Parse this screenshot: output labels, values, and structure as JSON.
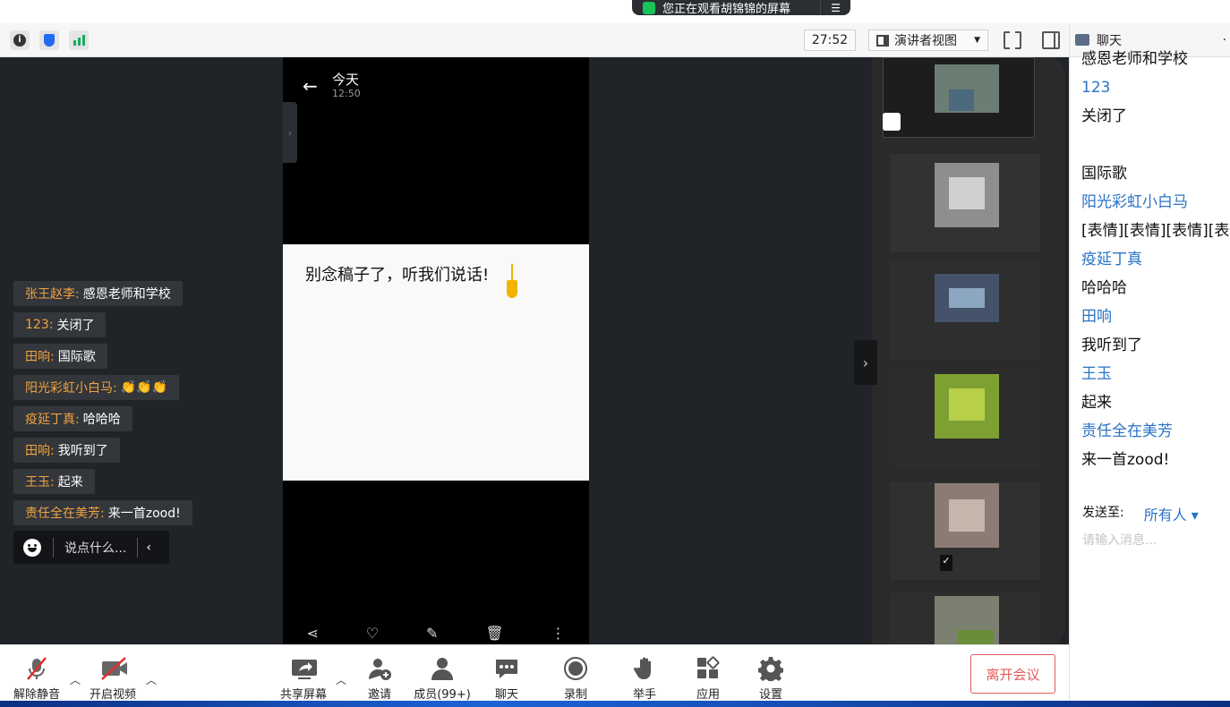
{
  "banner": {
    "text": "您正在观看胡锦锦的屏幕",
    "menu_icon": "list-icon"
  },
  "header": {
    "timer": "27:52",
    "view_mode": "演讲者视图",
    "icons": [
      "info-icon",
      "shield-icon",
      "signal-icon",
      "fullscreen-icon",
      "side-panel-icon"
    ]
  },
  "phone": {
    "day": "今天",
    "time": "12:50",
    "note_text": "别念稿子了，听我们说话!",
    "tools": [
      "share-icon",
      "heart-icon",
      "pen-icon",
      "trash-icon",
      "more-icon"
    ]
  },
  "danmaku": [
    {
      "who": "张王赵李:",
      "text": "感恩老师和学校"
    },
    {
      "who": "123:",
      "text": "关闭了"
    },
    {
      "who": "田响:",
      "text": "国际歌"
    },
    {
      "who": "阳光彩虹小白马:",
      "text": "👏👏👏"
    },
    {
      "who": "疫延丁真:",
      "text": "哈哈哈"
    },
    {
      "who": "田响:",
      "text": "我听到了"
    },
    {
      "who": "王玉:",
      "text": "起来"
    },
    {
      "who": "责任全在美芳:",
      "text": "来一首zood!"
    }
  ],
  "danmaku_input": {
    "placeholder": "说点什么..."
  },
  "chat": {
    "title": "聊天",
    "messages": [
      {
        "type": "text",
        "value": "感恩老师和学校"
      },
      {
        "type": "sender",
        "value": "123"
      },
      {
        "type": "text",
        "value": "关闭了"
      },
      {
        "type": "sender",
        "value": ""
      },
      {
        "type": "text",
        "value": "国际歌"
      },
      {
        "type": "sender",
        "value": "阳光彩虹小白马"
      },
      {
        "type": "text",
        "value": "[表情][表情][表情][表情]"
      },
      {
        "type": "sender",
        "value": "疫延丁真"
      },
      {
        "type": "text",
        "value": "哈哈哈"
      },
      {
        "type": "sender",
        "value": "田响"
      },
      {
        "type": "text",
        "value": "我听到了"
      },
      {
        "type": "sender",
        "value": "王玉"
      },
      {
        "type": "text",
        "value": "起来"
      },
      {
        "type": "sender",
        "value": "责任全在美芳"
      },
      {
        "type": "text",
        "value": "来一首zood!"
      }
    ],
    "send_to_label": "发送至:",
    "send_to_value": "所有人 ▾",
    "input_placeholder": "请输入消息..."
  },
  "toolbar": {
    "unmute": "解除静音",
    "start_video": "开启视频",
    "share_screen": "共享屏幕",
    "invite": "邀请",
    "members": "成员(99+)",
    "chat": "聊天",
    "record": "录制",
    "raise_hand": "举手",
    "apps": "应用",
    "settings": "设置",
    "leave": "离开会议"
  }
}
